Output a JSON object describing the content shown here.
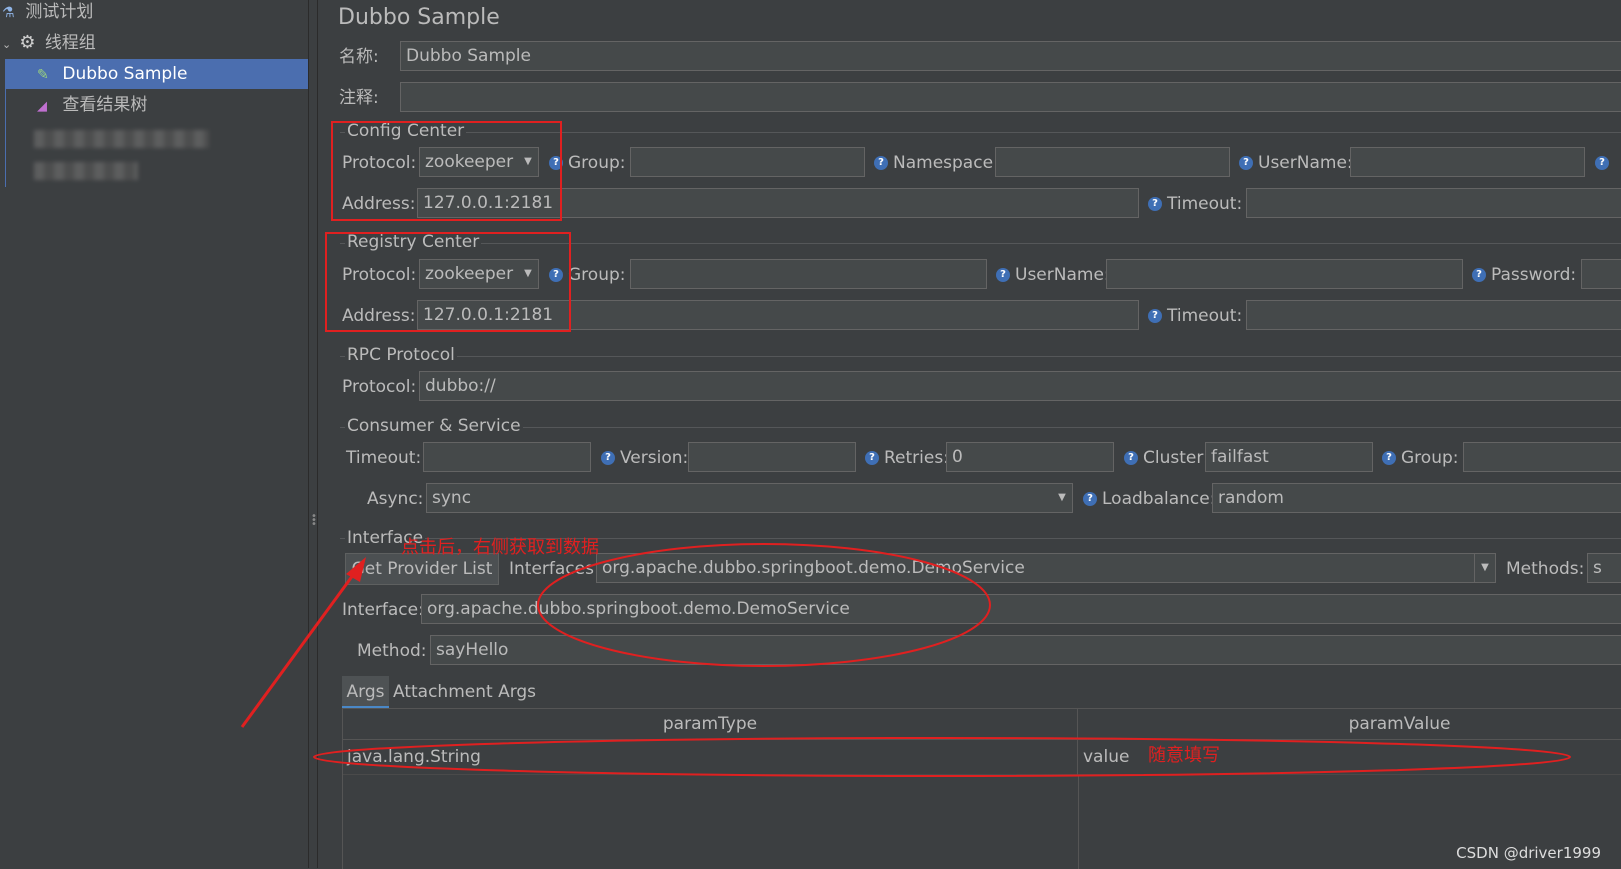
{
  "sidebar": {
    "items": [
      {
        "label": "测试计划",
        "icon": "flask-icon"
      },
      {
        "label": "线程组",
        "icon": "gear-icon"
      },
      {
        "label": "Dubbo Sample",
        "icon": "pipette-icon"
      },
      {
        "label": "查看结果树",
        "icon": "chart-icon"
      }
    ]
  },
  "main": {
    "title": "Dubbo Sample",
    "name_label": "名称:",
    "name_value": "Dubbo Sample",
    "comment_label": "注释:",
    "comment_value": ""
  },
  "config_center": {
    "title": "Config Center",
    "protocol_label": "Protocol:",
    "protocol_value": "zookeeper",
    "group_label": "Group:",
    "namespace_label": "Namespace:",
    "username_label": "UserName:",
    "address_label": "Address:",
    "address_value": "127.0.0.1:2181",
    "timeout_label": "Timeout:"
  },
  "registry_center": {
    "title": "Registry Center",
    "protocol_label": "Protocol:",
    "protocol_value": "zookeeper",
    "group_label": "Group:",
    "username_label": "UserName:",
    "password_label": "Password:",
    "address_label": "Address:",
    "address_value": "127.0.0.1:2181",
    "timeout_label": "Timeout:"
  },
  "rpc": {
    "title": "RPC Protocol",
    "protocol_label": "Protocol:",
    "protocol_value": "dubbo://"
  },
  "consumer": {
    "title": "Consumer & Service",
    "timeout_label": "Timeout:",
    "version_label": "Version:",
    "retries_label": "Retries:",
    "retries_value": "0",
    "cluster_label": "Cluster:",
    "cluster_value": "failfast",
    "group_label": "Group:",
    "async_label": "Async:",
    "async_value": "sync",
    "loadbalance_label": "Loadbalance:",
    "loadbalance_value": "random"
  },
  "interface": {
    "title": "Interface",
    "get_provider_label": "Get Provider List",
    "interfaces_label": "Interfaces:",
    "interfaces_value": "org.apache.dubbo.springboot.demo.DemoService",
    "methods_label": "Methods:",
    "methods_value": "s",
    "interface_label": "Interface:",
    "interface_value": "org.apache.dubbo.springboot.demo.DemoService",
    "method_label": "Method:",
    "method_value": "sayHello"
  },
  "tabs": [
    {
      "label": "Args",
      "active": true
    },
    {
      "label": "Attachment Args",
      "active": false
    }
  ],
  "args_table": {
    "headers": [
      "paramType",
      "paramValue"
    ],
    "rows": [
      [
        "java.lang.String",
        "value"
      ]
    ]
  },
  "annotations": {
    "click_note": "点击后，右侧获取到数据",
    "fill_note": "随意填写",
    "color": "#e02020"
  },
  "watermark": "CSDN @driver1999"
}
